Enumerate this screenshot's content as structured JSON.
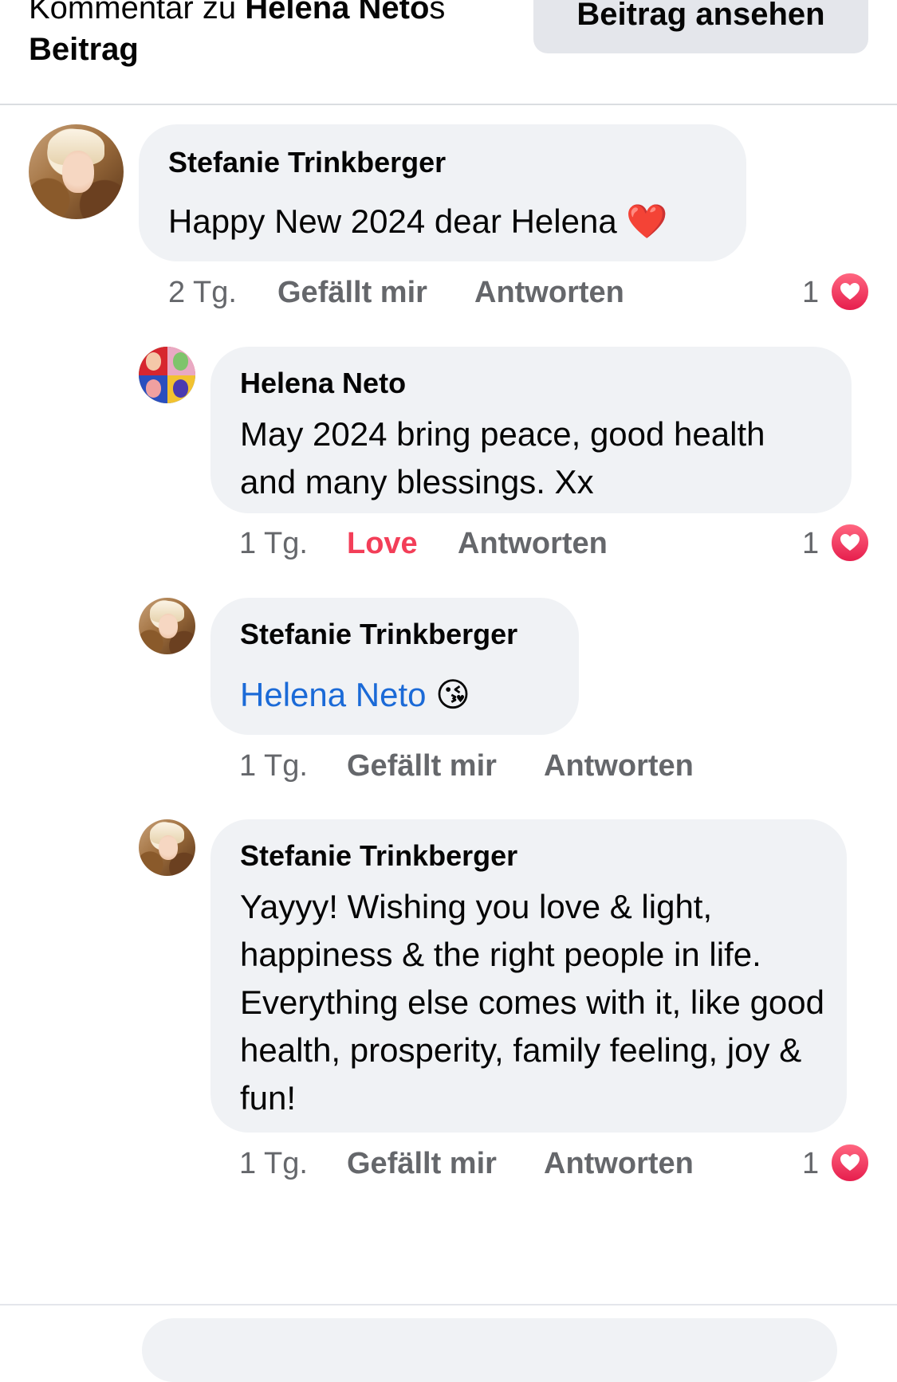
{
  "header": {
    "title_prefix": "Kommentar zu ",
    "title_name": "Helena Neto",
    "title_suffix": "s",
    "title_line2": "Beitrag",
    "view_post_button": "Beitrag ansehen"
  },
  "comments": [
    {
      "author": "Stefanie Trinkberger",
      "text": "Happy New 2024 dear Helena ❤️",
      "time": "2 Tg.",
      "like_label": "Gefällt mir",
      "reply_label": "Antworten",
      "reaction_count": "1"
    },
    {
      "author": "Helena Neto",
      "text": "May 2024 bring peace, good health and many blessings. Xx",
      "time": "1 Tg.",
      "like_label": "Love",
      "reply_label": "Antworten",
      "reaction_count": "1"
    },
    {
      "author": "Stefanie Trinkberger",
      "mention": "Helena Neto",
      "text": " 😘",
      "time": "1 Tg.",
      "like_label": "Gefällt mir",
      "reply_label": "Antworten"
    },
    {
      "author": "Stefanie Trinkberger",
      "text": "Yayyy! Wishing you love & light, happiness & the right people in life. Everything else comes with it, like good health, prosperity, family feeling, joy & fun!",
      "time": "1 Tg.",
      "like_label": "Gefällt mir",
      "reply_label": "Antworten",
      "reaction_count": "1"
    }
  ],
  "colors": {
    "bubble": "#f0f2f5",
    "secondary_text": "#65676b",
    "love": "#f33e58",
    "mention": "#1b6ad7"
  }
}
